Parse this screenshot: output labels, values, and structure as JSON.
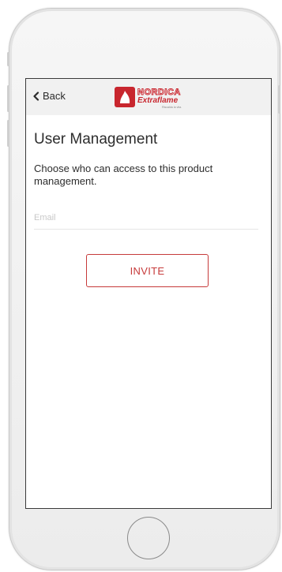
{
  "navbar": {
    "back_label": "Back",
    "logo": {
      "brand_top": "NORDICA",
      "brand_bottom": "Extraflame",
      "tagline": "Riscalda la vita.",
      "brand_color": "#c8262e"
    }
  },
  "main": {
    "title": "User Management",
    "description": "Choose who can access to this product management.",
    "email_placeholder": "Email",
    "email_value": "",
    "invite_label": "INVITE"
  },
  "colors": {
    "accent": "#c63a3a",
    "navbar_bg": "#f1f1f1",
    "text": "#2d2d2d"
  },
  "icons": {
    "back": "chevron-left-icon",
    "home": "home-button"
  }
}
